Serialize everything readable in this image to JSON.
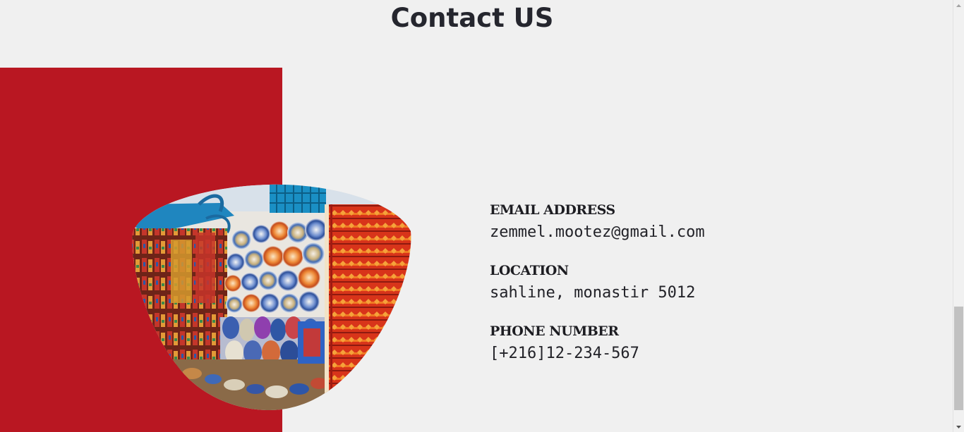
{
  "section": {
    "title": "Contact US"
  },
  "contact": {
    "email_label": "EMAIL ADDRESS",
    "email_value": "zemmel.mootez@gmail.com",
    "location_label": "LOCATION",
    "location_value": "sahline, monastir 5012",
    "phone_label": "PHONE NUMBER",
    "phone_value": "[+216]12-234-567"
  },
  "image": {
    "subject": "tunisian-souk-market-photo"
  },
  "colors": {
    "accent_red": "#b91722",
    "background": "#f0f0f0",
    "text_dark": "#25262e"
  }
}
